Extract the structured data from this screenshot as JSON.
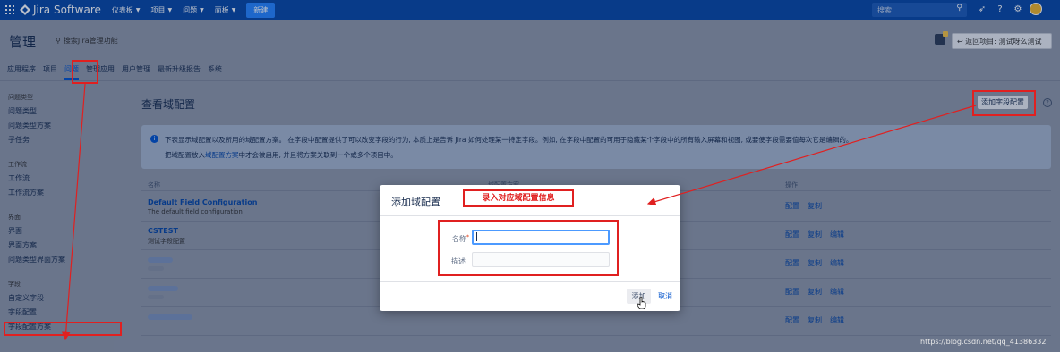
{
  "topbar": {
    "brand": "Jira Software",
    "nav": [
      "仪表板",
      "项目",
      "问题",
      "面板"
    ],
    "create_label": "新建",
    "search_placeholder": "搜索"
  },
  "admin": {
    "title": "管理",
    "search_label": "搜索Jira管理功能",
    "back_label": "返回项目: 测试呀么测试"
  },
  "tabs": [
    "应用程序",
    "项目",
    "问题",
    "管理应用",
    "用户管理",
    "最新升级报告",
    "系统"
  ],
  "sidebar": {
    "groups": [
      {
        "title": "问题类型",
        "items": [
          "问题类型",
          "问题类型方案",
          "子任务"
        ]
      },
      {
        "title": "工作流",
        "items": [
          "工作流",
          "工作流方案"
        ]
      },
      {
        "title": "界面",
        "items": [
          "界面",
          "界面方案",
          "问题类型界面方案"
        ]
      },
      {
        "title": "字段",
        "items": [
          "自定义字段",
          "字段配置",
          "字段配置方案"
        ]
      }
    ]
  },
  "main": {
    "title": "查看域配置",
    "add_button": "添加字段配置",
    "info_line1": "下表显示域配置以及所用的域配置方案。 在字段中配置提供了可以改变字段的行为, 本质上是告诉 Jira 如何处理某一特定字段。例如, 在字段中配置的可用于隐藏某个字段中的所有输入屏幕和视图, 或要使字段需要值每次它是编辑的。",
    "info_line2_pre": "把域配置放入",
    "info_line2_link": "域配置方案",
    "info_line2_post": "中才会被启用, 并且将方案关联到一个或多个项目中。",
    "columns": [
      "名称",
      "域配置方案",
      "操作"
    ],
    "rows": [
      {
        "name": "Default Field Configuration",
        "desc": "The default field configuration",
        "actions": [
          "配置",
          "复制"
        ]
      },
      {
        "name": "CSTEST",
        "desc": "测试字段配置",
        "actions": [
          "配置",
          "复制",
          "编辑"
        ]
      },
      {
        "name": "",
        "desc": "",
        "actions": [
          "配置",
          "复制",
          "编辑"
        ]
      },
      {
        "name": "",
        "desc": "",
        "actions": [
          "配置",
          "复制",
          "编辑"
        ]
      },
      {
        "name": "",
        "desc": "",
        "actions": [
          "配置",
          "复制",
          "编辑"
        ]
      }
    ]
  },
  "dialog": {
    "title": "添加域配置",
    "name_label": "名称",
    "required_mark": "*",
    "desc_label": "描述",
    "name_value": "",
    "desc_value": "",
    "add_label": "添加",
    "cancel_label": "取消"
  },
  "annotation": {
    "note": "录入对应域配置信息",
    "color": "#e02020"
  },
  "watermark": "https://blog.csdn.net/qq_41386332"
}
